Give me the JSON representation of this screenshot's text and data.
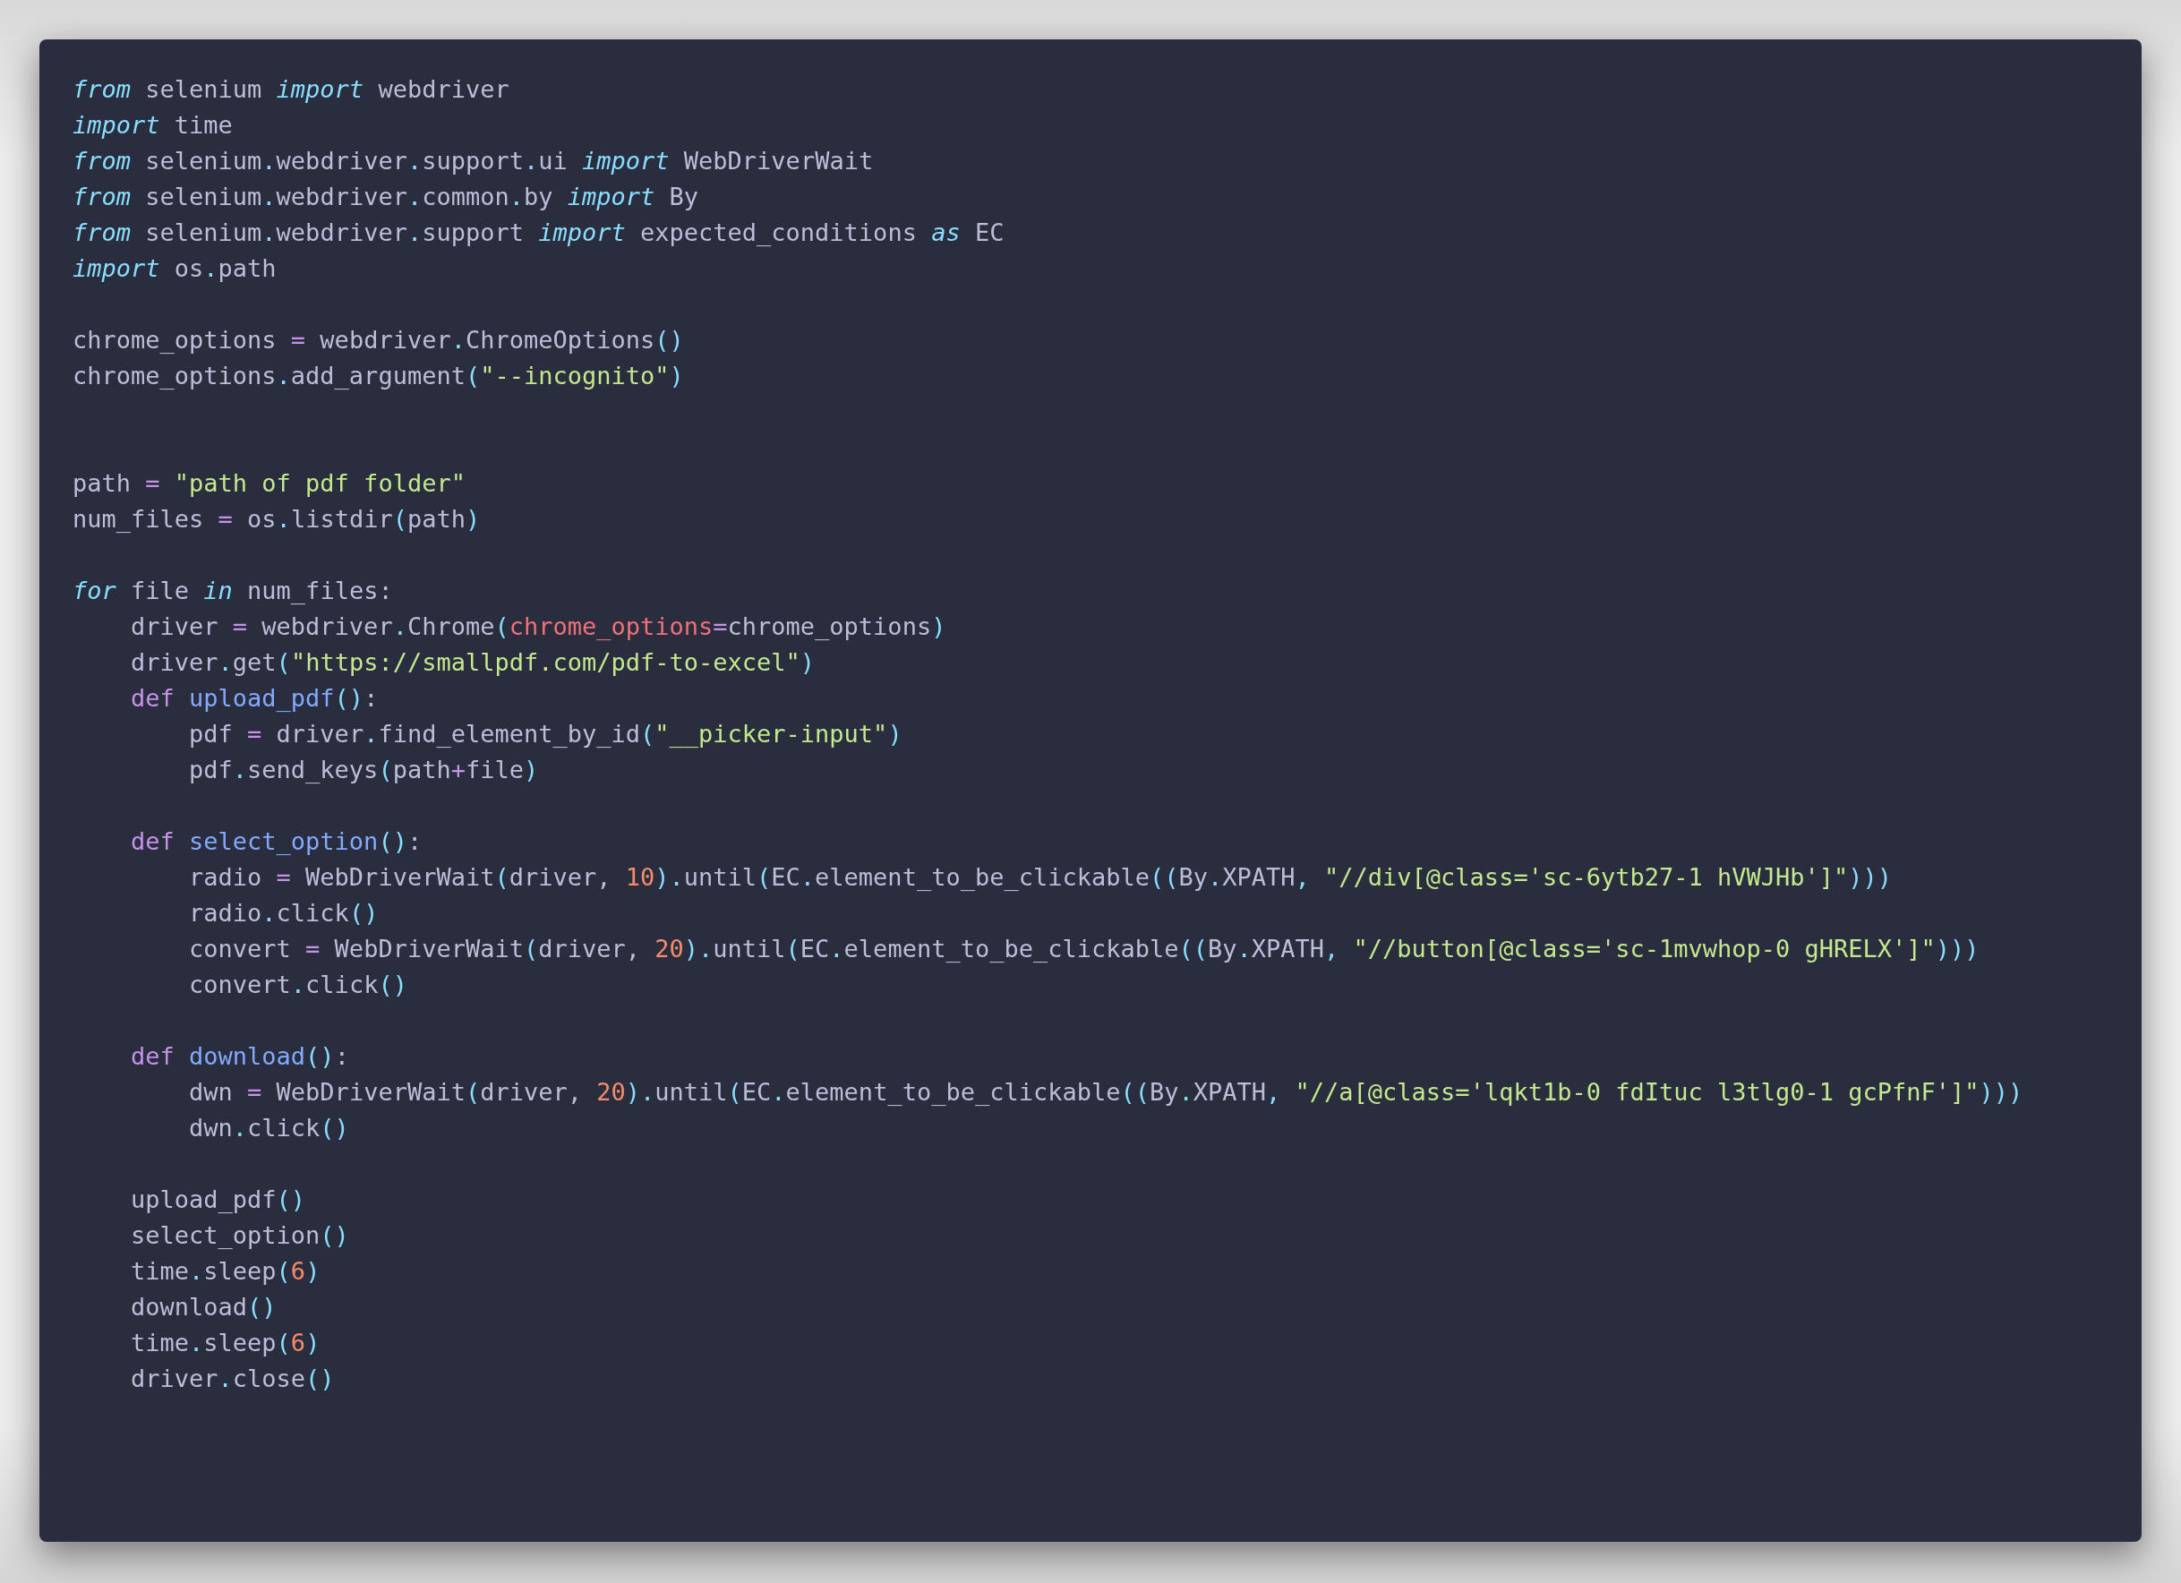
{
  "code_window": {
    "lines": [
      {
        "kind": "code",
        "tokens": [
          {
            "kind": "k",
            "text": "from"
          },
          {
            "kind": "p",
            "text": " selenium "
          },
          {
            "kind": "k",
            "text": "import"
          },
          {
            "kind": "p",
            "text": " webdriver"
          }
        ]
      },
      {
        "kind": "code",
        "tokens": [
          {
            "kind": "k",
            "text": "import"
          },
          {
            "kind": "p",
            "text": " time"
          }
        ]
      },
      {
        "kind": "code",
        "tokens": [
          {
            "kind": "k",
            "text": "from"
          },
          {
            "kind": "p",
            "text": " selenium"
          },
          {
            "kind": "c",
            "text": "."
          },
          {
            "kind": "p",
            "text": "webdriver"
          },
          {
            "kind": "c",
            "text": "."
          },
          {
            "kind": "p",
            "text": "support"
          },
          {
            "kind": "c",
            "text": "."
          },
          {
            "kind": "p",
            "text": "ui "
          },
          {
            "kind": "k",
            "text": "import"
          },
          {
            "kind": "p",
            "text": " WebDriverWait"
          }
        ]
      },
      {
        "kind": "code",
        "tokens": [
          {
            "kind": "k",
            "text": "from"
          },
          {
            "kind": "p",
            "text": " selenium"
          },
          {
            "kind": "c",
            "text": "."
          },
          {
            "kind": "p",
            "text": "webdriver"
          },
          {
            "kind": "c",
            "text": "."
          },
          {
            "kind": "p",
            "text": "common"
          },
          {
            "kind": "c",
            "text": "."
          },
          {
            "kind": "p",
            "text": "by "
          },
          {
            "kind": "k",
            "text": "import"
          },
          {
            "kind": "p",
            "text": " By"
          }
        ]
      },
      {
        "kind": "code",
        "tokens": [
          {
            "kind": "k",
            "text": "from"
          },
          {
            "kind": "p",
            "text": " selenium"
          },
          {
            "kind": "c",
            "text": "."
          },
          {
            "kind": "p",
            "text": "webdriver"
          },
          {
            "kind": "c",
            "text": "."
          },
          {
            "kind": "p",
            "text": "support "
          },
          {
            "kind": "k",
            "text": "import"
          },
          {
            "kind": "p",
            "text": " expected_conditions "
          },
          {
            "kind": "k",
            "text": "as"
          },
          {
            "kind": "p",
            "text": " EC"
          }
        ]
      },
      {
        "kind": "code",
        "tokens": [
          {
            "kind": "k",
            "text": "import"
          },
          {
            "kind": "p",
            "text": " os"
          },
          {
            "kind": "c",
            "text": "."
          },
          {
            "kind": "p",
            "text": "path"
          }
        ]
      },
      {
        "kind": "blank"
      },
      {
        "kind": "code",
        "tokens": [
          {
            "kind": "p",
            "text": "chrome_options "
          },
          {
            "kind": "o",
            "text": "="
          },
          {
            "kind": "p",
            "text": " webdriver"
          },
          {
            "kind": "c",
            "text": "."
          },
          {
            "kind": "p",
            "text": "ChromeOptions"
          },
          {
            "kind": "c",
            "text": "()"
          }
        ]
      },
      {
        "kind": "code",
        "tokens": [
          {
            "kind": "p",
            "text": "chrome_options"
          },
          {
            "kind": "c",
            "text": "."
          },
          {
            "kind": "p",
            "text": "add_argument"
          },
          {
            "kind": "c",
            "text": "("
          },
          {
            "kind": "s",
            "text": "\"--incognito\""
          },
          {
            "kind": "c",
            "text": ")"
          }
        ]
      },
      {
        "kind": "blank"
      },
      {
        "kind": "blank"
      },
      {
        "kind": "code",
        "tokens": [
          {
            "kind": "p",
            "text": "path "
          },
          {
            "kind": "o",
            "text": "="
          },
          {
            "kind": "s",
            "text": " \"path of pdf folder\""
          }
        ]
      },
      {
        "kind": "code",
        "tokens": [
          {
            "kind": "p",
            "text": "num_files "
          },
          {
            "kind": "o",
            "text": "="
          },
          {
            "kind": "p",
            "text": " os"
          },
          {
            "kind": "c",
            "text": "."
          },
          {
            "kind": "p",
            "text": "listdir"
          },
          {
            "kind": "c",
            "text": "("
          },
          {
            "kind": "p",
            "text": "path"
          },
          {
            "kind": "c",
            "text": ")"
          }
        ]
      },
      {
        "kind": "blank"
      },
      {
        "kind": "code",
        "tokens": [
          {
            "kind": "k",
            "text": "for"
          },
          {
            "kind": "p",
            "text": " file "
          },
          {
            "kind": "k",
            "text": "in"
          },
          {
            "kind": "p",
            "text": " num_files:"
          }
        ]
      },
      {
        "kind": "code",
        "tokens": [
          {
            "kind": "p",
            "text": "    driver "
          },
          {
            "kind": "o",
            "text": "="
          },
          {
            "kind": "p",
            "text": " webdriver"
          },
          {
            "kind": "c",
            "text": "."
          },
          {
            "kind": "p",
            "text": "Chrome"
          },
          {
            "kind": "c",
            "text": "("
          },
          {
            "kind": "r",
            "text": "chrome_options"
          },
          {
            "kind": "o",
            "text": "="
          },
          {
            "kind": "p",
            "text": "chrome_options"
          },
          {
            "kind": "c",
            "text": ")"
          }
        ]
      },
      {
        "kind": "code",
        "tokens": [
          {
            "kind": "p",
            "text": "    driver"
          },
          {
            "kind": "c",
            "text": "."
          },
          {
            "kind": "p",
            "text": "get"
          },
          {
            "kind": "c",
            "text": "("
          },
          {
            "kind": "s",
            "text": "\"https://smallpdf.com/pdf-to-excel\""
          },
          {
            "kind": "c",
            "text": ")"
          }
        ]
      },
      {
        "kind": "code",
        "tokens": [
          {
            "kind": "d",
            "text": "    def"
          },
          {
            "kind": "f",
            "text": " upload_pdf"
          },
          {
            "kind": "c",
            "text": "()"
          },
          {
            "kind": "p",
            "text": ":"
          }
        ]
      },
      {
        "kind": "code",
        "tokens": [
          {
            "kind": "p",
            "text": "        pdf "
          },
          {
            "kind": "o",
            "text": "="
          },
          {
            "kind": "p",
            "text": " driver"
          },
          {
            "kind": "c",
            "text": "."
          },
          {
            "kind": "p",
            "text": "find_element_by_id"
          },
          {
            "kind": "c",
            "text": "("
          },
          {
            "kind": "s",
            "text": "\"__picker-input\""
          },
          {
            "kind": "c",
            "text": ")"
          }
        ]
      },
      {
        "kind": "code",
        "tokens": [
          {
            "kind": "p",
            "text": "        pdf"
          },
          {
            "kind": "c",
            "text": "."
          },
          {
            "kind": "p",
            "text": "send_keys"
          },
          {
            "kind": "c",
            "text": "("
          },
          {
            "kind": "p",
            "text": "path"
          },
          {
            "kind": "o",
            "text": "+"
          },
          {
            "kind": "p",
            "text": "file"
          },
          {
            "kind": "c",
            "text": ")"
          }
        ]
      },
      {
        "kind": "blank"
      },
      {
        "kind": "code",
        "tokens": [
          {
            "kind": "d",
            "text": "    def"
          },
          {
            "kind": "f",
            "text": " select_option"
          },
          {
            "kind": "c",
            "text": "()"
          },
          {
            "kind": "p",
            "text": ":"
          }
        ]
      },
      {
        "kind": "code",
        "tokens": [
          {
            "kind": "p",
            "text": "        radio "
          },
          {
            "kind": "o",
            "text": "="
          },
          {
            "kind": "p",
            "text": " WebDriverWait"
          },
          {
            "kind": "c",
            "text": "("
          },
          {
            "kind": "p",
            "text": "driver, "
          },
          {
            "kind": "n",
            "text": "10"
          },
          {
            "kind": "c",
            "text": ")."
          },
          {
            "kind": "p",
            "text": "until"
          },
          {
            "kind": "c",
            "text": "("
          },
          {
            "kind": "p",
            "text": "EC"
          },
          {
            "kind": "c",
            "text": "."
          },
          {
            "kind": "p",
            "text": "element_to_be_clickable"
          },
          {
            "kind": "c",
            "text": "(("
          },
          {
            "kind": "p",
            "text": "By"
          },
          {
            "kind": "c",
            "text": "."
          },
          {
            "kind": "p",
            "text": "XPATH"
          },
          {
            "kind": "c",
            "text": ", "
          },
          {
            "kind": "s",
            "text": "\"//div[@class='sc-6ytb27-1 hVWJHb']\""
          },
          {
            "kind": "c",
            "text": ")))"
          }
        ]
      },
      {
        "kind": "code",
        "tokens": [
          {
            "kind": "p",
            "text": "        radio"
          },
          {
            "kind": "c",
            "text": "."
          },
          {
            "kind": "p",
            "text": "click"
          },
          {
            "kind": "c",
            "text": "()"
          }
        ]
      },
      {
        "kind": "code",
        "tokens": [
          {
            "kind": "p",
            "text": "        convert "
          },
          {
            "kind": "o",
            "text": "="
          },
          {
            "kind": "p",
            "text": " WebDriverWait"
          },
          {
            "kind": "c",
            "text": "("
          },
          {
            "kind": "p",
            "text": "driver, "
          },
          {
            "kind": "n",
            "text": "20"
          },
          {
            "kind": "c",
            "text": ")."
          },
          {
            "kind": "p",
            "text": "until"
          },
          {
            "kind": "c",
            "text": "("
          },
          {
            "kind": "p",
            "text": "EC"
          },
          {
            "kind": "c",
            "text": "."
          },
          {
            "kind": "p",
            "text": "element_to_be_clickable"
          },
          {
            "kind": "c",
            "text": "(("
          },
          {
            "kind": "p",
            "text": "By"
          },
          {
            "kind": "c",
            "text": "."
          },
          {
            "kind": "p",
            "text": "XPATH"
          },
          {
            "kind": "c",
            "text": ", "
          },
          {
            "kind": "s",
            "text": "\"//button[@class='sc-1mvwhop-0 gHRELX']\""
          },
          {
            "kind": "c",
            "text": ")))"
          }
        ]
      },
      {
        "kind": "code",
        "tokens": [
          {
            "kind": "p",
            "text": "        convert"
          },
          {
            "kind": "c",
            "text": "."
          },
          {
            "kind": "p",
            "text": "click"
          },
          {
            "kind": "c",
            "text": "()"
          }
        ]
      },
      {
        "kind": "blank"
      },
      {
        "kind": "code",
        "tokens": [
          {
            "kind": "d",
            "text": "    def"
          },
          {
            "kind": "f",
            "text": " download"
          },
          {
            "kind": "c",
            "text": "()"
          },
          {
            "kind": "p",
            "text": ":"
          }
        ]
      },
      {
        "kind": "code",
        "tokens": [
          {
            "kind": "p",
            "text": "        dwn "
          },
          {
            "kind": "o",
            "text": "="
          },
          {
            "kind": "p",
            "text": " WebDriverWait"
          },
          {
            "kind": "c",
            "text": "("
          },
          {
            "kind": "p",
            "text": "driver, "
          },
          {
            "kind": "n",
            "text": "20"
          },
          {
            "kind": "c",
            "text": ")."
          },
          {
            "kind": "p",
            "text": "until"
          },
          {
            "kind": "c",
            "text": "("
          },
          {
            "kind": "p",
            "text": "EC"
          },
          {
            "kind": "c",
            "text": "."
          },
          {
            "kind": "p",
            "text": "element_to_be_clickable"
          },
          {
            "kind": "c",
            "text": "(("
          },
          {
            "kind": "p",
            "text": "By"
          },
          {
            "kind": "c",
            "text": "."
          },
          {
            "kind": "p",
            "text": "XPATH"
          },
          {
            "kind": "c",
            "text": ", "
          },
          {
            "kind": "s",
            "text": "\"//a[@class='lqkt1b-0 fdItuc l3tlg0-1 gcPfnF']\""
          },
          {
            "kind": "c",
            "text": ")))"
          }
        ]
      },
      {
        "kind": "code",
        "tokens": [
          {
            "kind": "p",
            "text": "        dwn"
          },
          {
            "kind": "c",
            "text": "."
          },
          {
            "kind": "p",
            "text": "click"
          },
          {
            "kind": "c",
            "text": "()"
          }
        ]
      },
      {
        "kind": "blank"
      },
      {
        "kind": "code",
        "tokens": [
          {
            "kind": "p",
            "text": "    upload_pdf"
          },
          {
            "kind": "c",
            "text": "()"
          }
        ]
      },
      {
        "kind": "code",
        "tokens": [
          {
            "kind": "p",
            "text": "    select_option"
          },
          {
            "kind": "c",
            "text": "()"
          }
        ]
      },
      {
        "kind": "code",
        "tokens": [
          {
            "kind": "p",
            "text": "    time"
          },
          {
            "kind": "c",
            "text": "."
          },
          {
            "kind": "p",
            "text": "sleep"
          },
          {
            "kind": "c",
            "text": "("
          },
          {
            "kind": "n",
            "text": "6"
          },
          {
            "kind": "c",
            "text": ")"
          }
        ]
      },
      {
        "kind": "code",
        "tokens": [
          {
            "kind": "p",
            "text": "    download"
          },
          {
            "kind": "c",
            "text": "()"
          }
        ]
      },
      {
        "kind": "code",
        "tokens": [
          {
            "kind": "p",
            "text": "    time"
          },
          {
            "kind": "c",
            "text": "."
          },
          {
            "kind": "p",
            "text": "sleep"
          },
          {
            "kind": "c",
            "text": "("
          },
          {
            "kind": "n",
            "text": "6"
          },
          {
            "kind": "c",
            "text": ")"
          }
        ]
      },
      {
        "kind": "code",
        "tokens": [
          {
            "kind": "p",
            "text": "    driver"
          },
          {
            "kind": "c",
            "text": "."
          },
          {
            "kind": "p",
            "text": "close"
          },
          {
            "kind": "c",
            "text": "()"
          }
        ]
      }
    ]
  }
}
